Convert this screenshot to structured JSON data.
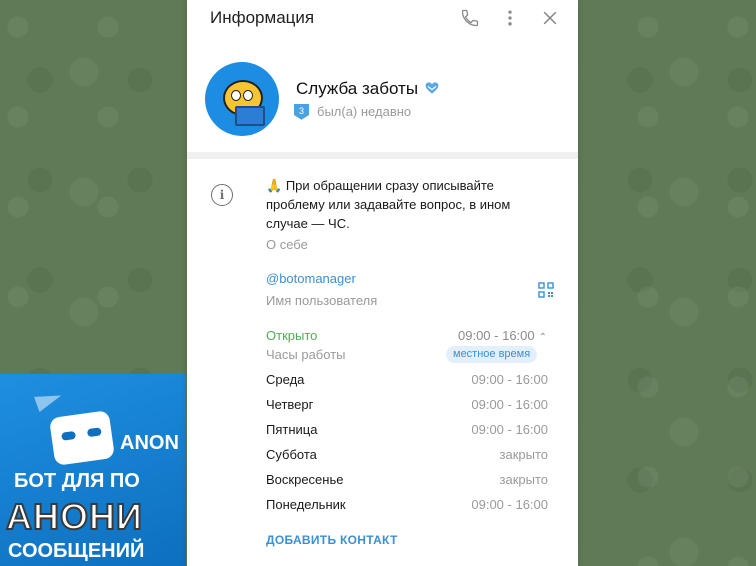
{
  "header": {
    "title": "Информация"
  },
  "profile": {
    "name": "Служба заботы",
    "level": "3",
    "status": "был(а) недавно"
  },
  "bio": {
    "emoji": "🙏",
    "text": "При обращении сразу описывайте проблему или задавайте вопрос, в ином случае — ЧС.",
    "label": "О себе"
  },
  "username": {
    "value": "@botomanager",
    "label": "Имя пользователя"
  },
  "hours": {
    "status": "Открыто",
    "today": "09:00 - 16:00",
    "label": "Часы работы",
    "timezone_badge": "местное время",
    "days": [
      {
        "day": "Среда",
        "time": "09:00 - 16:00"
      },
      {
        "day": "Четверг",
        "time": "09:00 - 16:00"
      },
      {
        "day": "Пятница",
        "time": "09:00 - 16:00"
      },
      {
        "day": "Суббота",
        "time": "закрыто"
      },
      {
        "day": "Воскресенье",
        "time": "закрыто"
      },
      {
        "day": "Понедельник",
        "time": "09:00 - 16:00"
      }
    ]
  },
  "actions": {
    "add_contact": "ДОБАВИТЬ КОНТАКТ"
  },
  "promo": {
    "brand": "ANON",
    "line1": "БОТ ДЛЯ ПО",
    "line2": "АНОНИ",
    "line3": "СООБЩЕНИЙ"
  },
  "colors": {
    "accent": "#3a8fd6",
    "open_status": "#4caf50",
    "background": "#5f7a55",
    "promo": "#1f8fe0"
  },
  "icons": {
    "call": "phone-icon",
    "more": "more-vertical-icon",
    "close": "close-icon",
    "info": "info-icon",
    "qr": "qr-code-icon",
    "verified": "verified-heart-icon"
  }
}
